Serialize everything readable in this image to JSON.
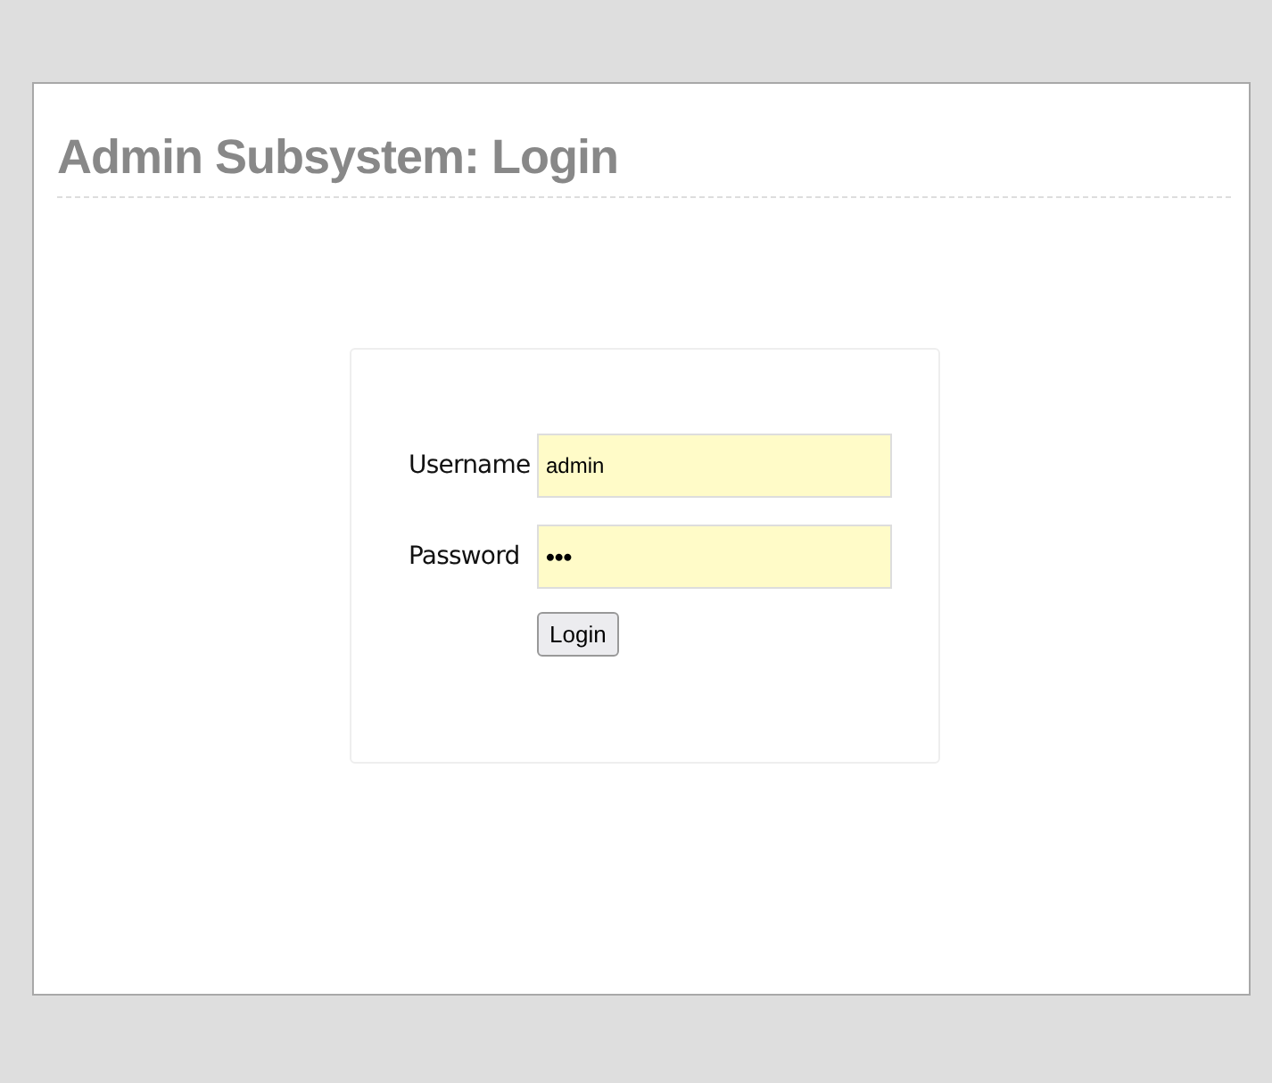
{
  "page": {
    "title": "Admin Subsystem: Login"
  },
  "form": {
    "fields": [
      {
        "label": "Username",
        "value": "admin"
      },
      {
        "label": "Password",
        "value": "•••"
      }
    ],
    "submit": "Login"
  }
}
